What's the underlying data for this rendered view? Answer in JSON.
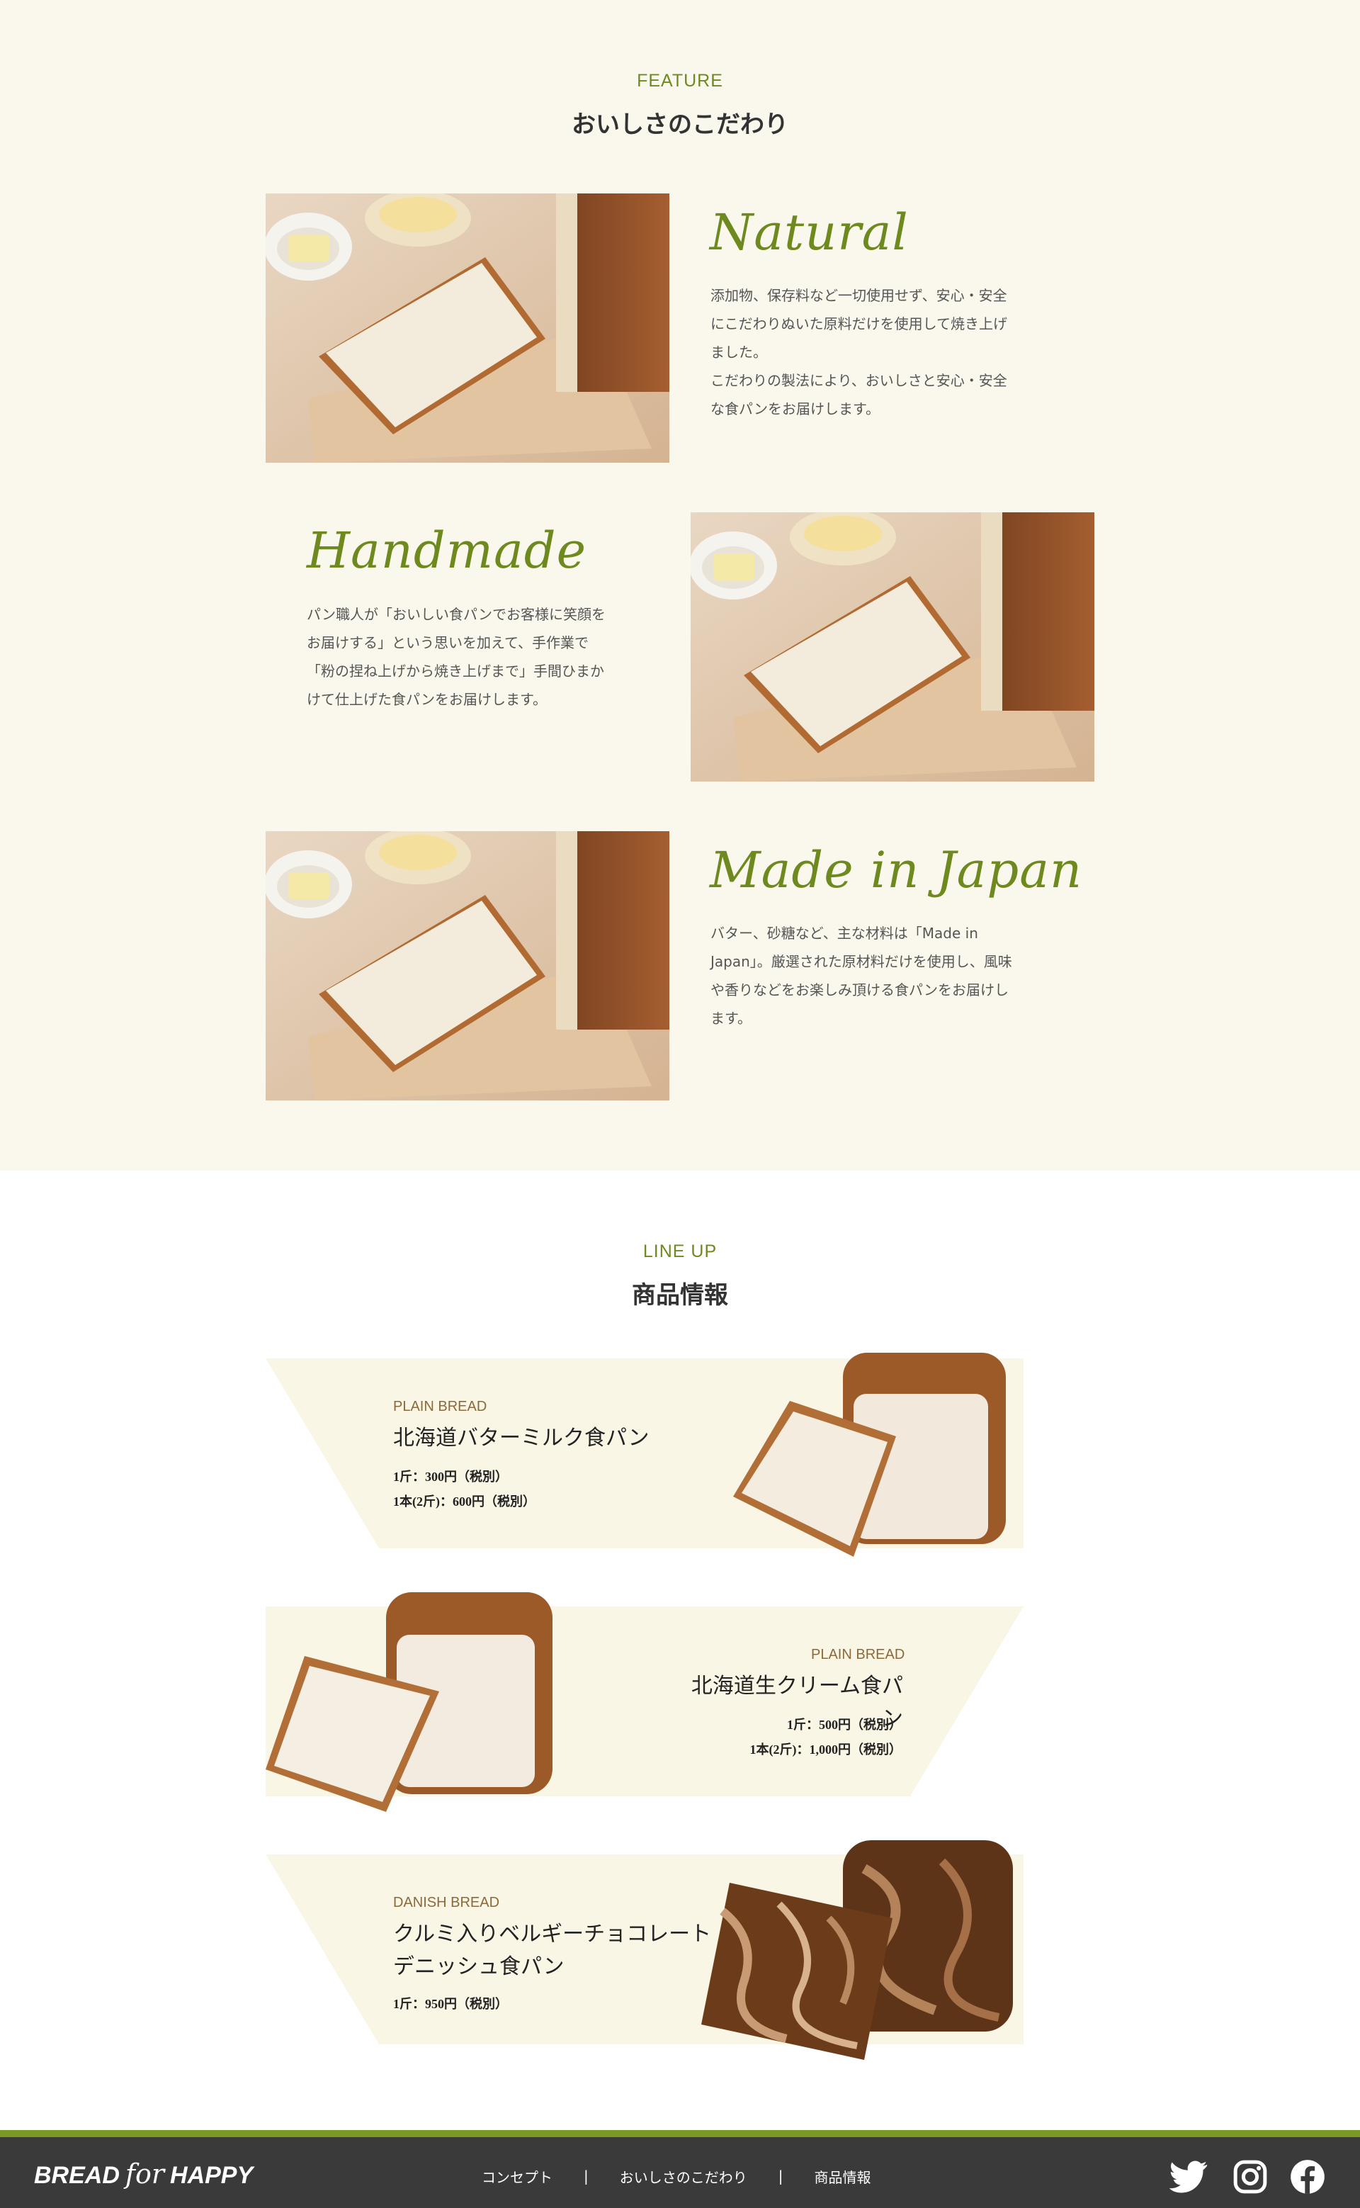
{
  "feature": {
    "kicker": "FEATURE",
    "title": "おいしさのこだわり",
    "items": [
      {
        "heading": "Natural",
        "text": "添加物、保存料など一切使用せず、安心・安全\nにこだわりぬいた原料だけを使用して焼き上げ\nました。\nこだわりの製法により、おいしさと安心・安全\nな食パンをお届けします。"
      },
      {
        "heading": "Handmade",
        "text": "パン職人が「おいしい食パンでお客様に笑顔を\nお届けする」という思いを加えて、手作業で\n「粉の捏ね上げから焼き上げまで」手間ひまか\nけて仕上げた食パンをお届けします。"
      },
      {
        "heading": "Made in Japan",
        "text": "バター、砂糖など、主な材料は「Made in\nJapan」。厳選された原材料だけを使用し、風味\nや香りなどをお楽しみ頂ける食パンをお届けし\nます。"
      }
    ]
  },
  "lineup": {
    "kicker": "LINE UP",
    "title": "商品情報",
    "products": [
      {
        "category": "PLAIN BREAD",
        "name": "北海道バターミルク食パン",
        "prices": [
          "1斤：300円（税別）",
          "1本(2斤)：600円（税別）"
        ]
      },
      {
        "category": "PLAIN BREAD",
        "name": "北海道生クリーム食パン",
        "prices": [
          "1斤：500円（税別）",
          "1本(2斤)：1,000円（税別）"
        ]
      },
      {
        "category": "DANISH BREAD",
        "name": "クルミ入りベルギーチョコレート\nデニッシュ食パン",
        "prices": [
          "1斤：950円（税別）"
        ]
      }
    ]
  },
  "footer": {
    "logo": {
      "left": "BREAD",
      "middle": "for",
      "right": "HAPPY"
    },
    "nav": [
      "コンセプト",
      "おいしさのこだわり",
      "商品情報"
    ],
    "separator": "|",
    "social": [
      "twitter-icon",
      "instagram-icon",
      "facebook-icon"
    ]
  },
  "colors": {
    "accent": "#6e8a1e",
    "feature_bg": "#faf8ed",
    "band_bg": "#faf6e6",
    "footer_bg": "#3a3a3a",
    "footer_bar": "#7a9a26"
  }
}
